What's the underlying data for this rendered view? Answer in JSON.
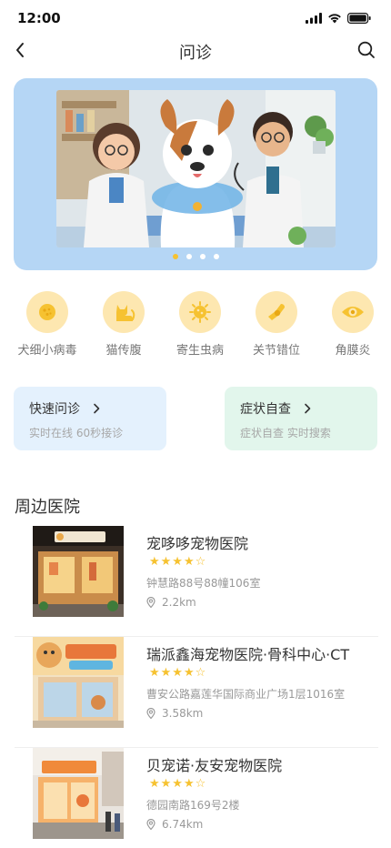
{
  "status_bar": {
    "time": "12:00"
  },
  "nav": {
    "title": "问诊"
  },
  "banner": {
    "image_alt": "Cartoon vets examining a dog",
    "dots": 4,
    "active_dot": 0
  },
  "categories": [
    {
      "label": "犬细小病毒",
      "icon": "virus-icon"
    },
    {
      "label": "猫传腹",
      "icon": "cat-icon"
    },
    {
      "label": "寄生虫病",
      "icon": "parasite-icon"
    },
    {
      "label": "关节错位",
      "icon": "joint-icon"
    },
    {
      "label": "角膜炎",
      "icon": "eye-icon"
    }
  ],
  "quick_consult": {
    "title": "快速问诊",
    "subtitle": "实时在线 60秒接诊"
  },
  "symptom_check": {
    "title": "症状自查",
    "subtitle": "症状自查 实时搜索"
  },
  "nearby": {
    "title": "周边医院",
    "hospitals": [
      {
        "name": "宠哆哆宠物医院",
        "rating": 4,
        "address": "钟慧路88号88幢106室",
        "distance": "2.2km"
      },
      {
        "name": "瑞派鑫海宠物医院·骨科中心·CT",
        "rating": 4,
        "address": "曹安公路嘉莲华国际商业广场1层1016室",
        "distance": "3.58km"
      },
      {
        "name": "贝宠诺·友安宠物医院",
        "rating": 4,
        "address": "德园南路169号2楼",
        "distance": "6.74km"
      }
    ]
  },
  "colors": {
    "accent": "#f6c231",
    "banner_bg": "#b5d6f5",
    "icon_circle": "#fde7b0"
  }
}
